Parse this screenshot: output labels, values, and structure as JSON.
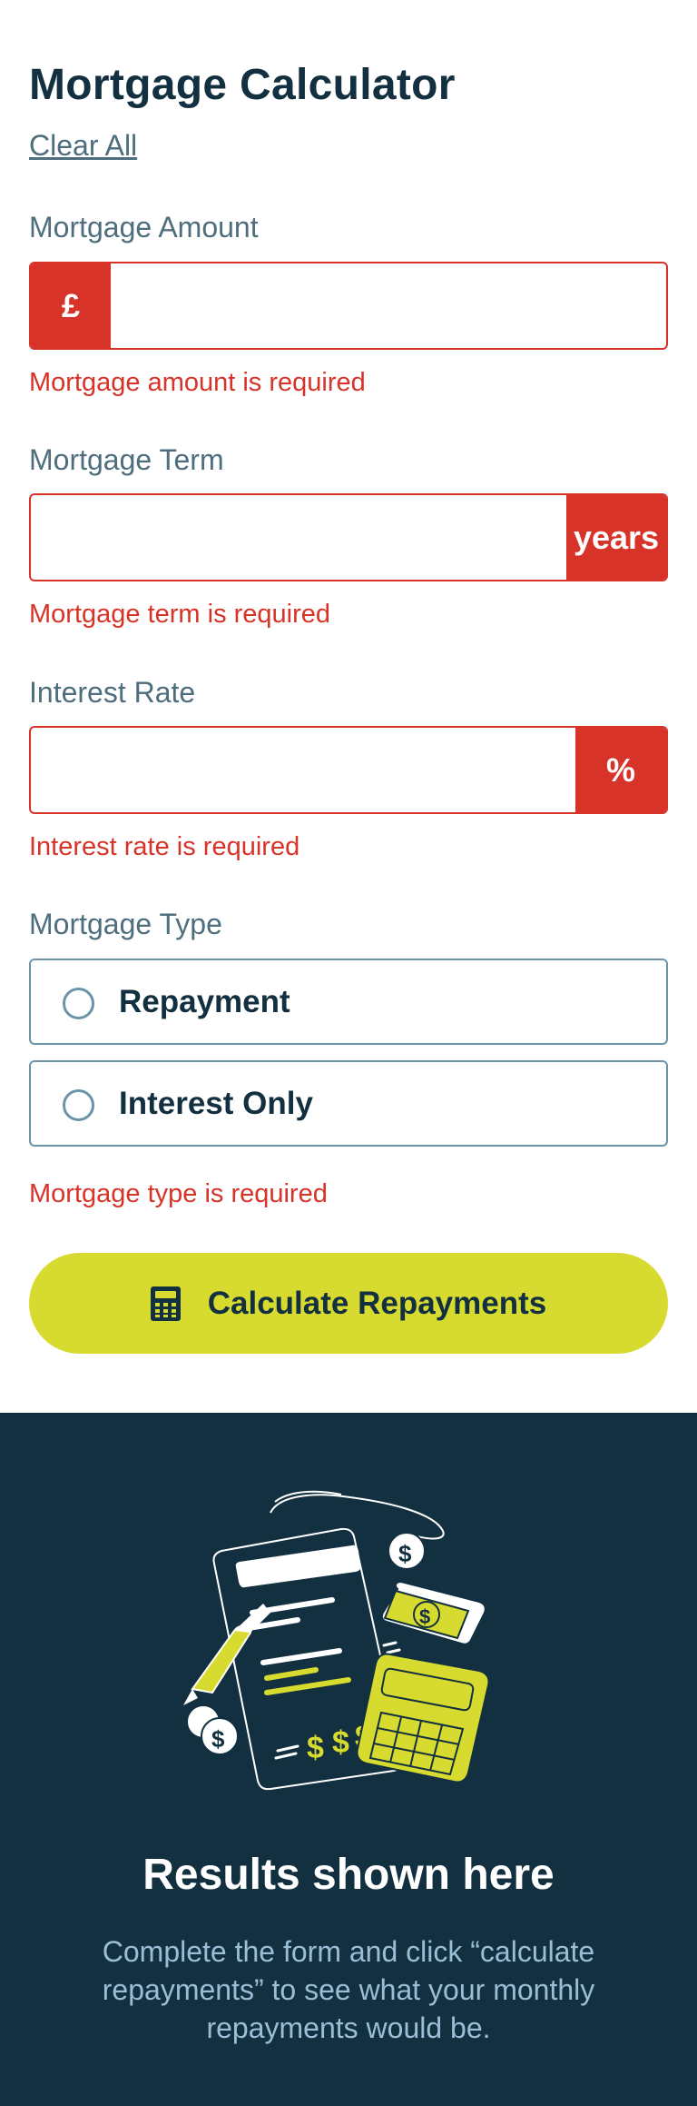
{
  "header": {
    "title": "Mortgage Calculator",
    "clear_label": "Clear All"
  },
  "amount": {
    "label": "Mortgage Amount",
    "prefix": "£",
    "value": "",
    "error": "Mortgage amount is required"
  },
  "term": {
    "label": "Mortgage Term",
    "suffix": "years",
    "value": "",
    "error": "Mortgage term is required"
  },
  "rate": {
    "label": "Interest Rate",
    "suffix": "%",
    "value": "",
    "error": "Interest rate is required"
  },
  "type": {
    "label": "Mortgage Type",
    "options": [
      {
        "label": "Repayment",
        "selected": false
      },
      {
        "label": "Interest Only",
        "selected": false
      }
    ],
    "error": "Mortgage type is required"
  },
  "submit": {
    "label": "Calculate Repayments",
    "icon": "calculator-icon"
  },
  "results": {
    "illustration": "empty-results-illustration",
    "title": "Results shown here",
    "text": "Complete the form and click “calculate repayments” to see what your monthly repayments would be."
  },
  "colors": {
    "slate_900": "#133041",
    "slate_700": "#4e6e7e",
    "slate_500": "#6b94a8",
    "slate_300": "#9abed5",
    "lime": "#d8db2f",
    "red": "#d73328",
    "white": "#ffffff"
  }
}
